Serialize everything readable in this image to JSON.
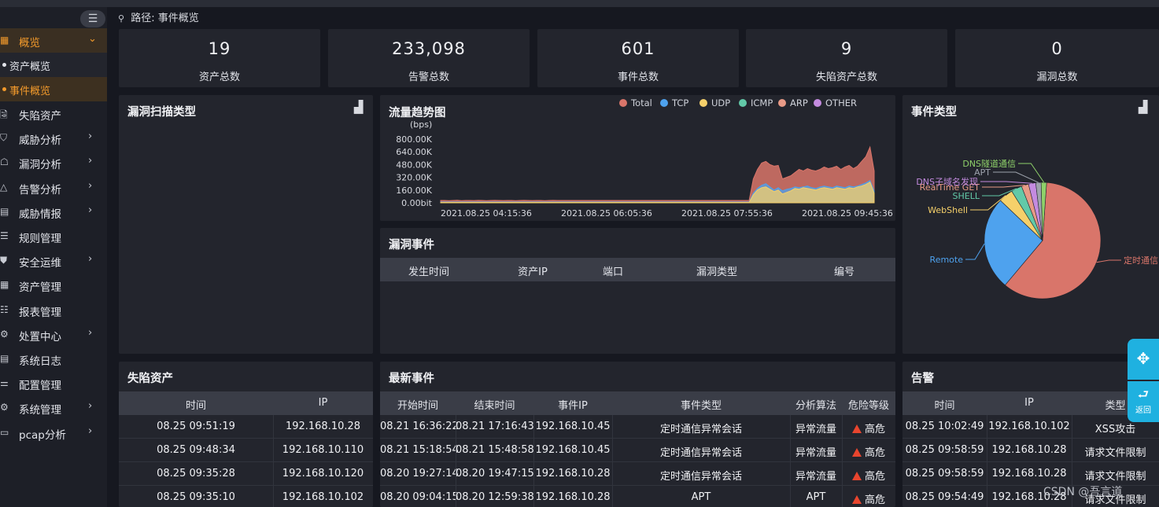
{
  "breadcrumb": {
    "prefix": "路径:",
    "current": "事件概览"
  },
  "sidebar": {
    "collapse_icon": "menu-fold-icon",
    "overview": {
      "label": "概览"
    },
    "sub_items": [
      {
        "label": "资产概览"
      },
      {
        "label": "事件概览"
      }
    ],
    "items": [
      {
        "label": "失陷资产"
      },
      {
        "label": "威胁分析"
      },
      {
        "label": "漏洞分析"
      },
      {
        "label": "告警分析"
      },
      {
        "label": "威胁情报"
      },
      {
        "label": "规则管理"
      },
      {
        "label": "安全运维"
      },
      {
        "label": "资产管理"
      },
      {
        "label": "报表管理"
      },
      {
        "label": "处置中心"
      },
      {
        "label": "系统日志"
      },
      {
        "label": "配置管理"
      },
      {
        "label": "系统管理"
      },
      {
        "label": "pcap分析"
      }
    ]
  },
  "stats": [
    {
      "value": "19",
      "label": "资产总数"
    },
    {
      "value": "233,098",
      "label": "告警总数"
    },
    {
      "value": "601",
      "label": "事件总数"
    },
    {
      "value": "9",
      "label": "失陷资产总数"
    },
    {
      "value": "0",
      "label": "漏洞总数"
    }
  ],
  "panels": {
    "vuln_scan": {
      "title": "漏洞扫描类型"
    },
    "traffic": {
      "title": "流量趋势图"
    },
    "event_type": {
      "title": "事件类型"
    },
    "vuln_events": {
      "title": "漏洞事件",
      "columns": [
        "发生时间",
        "资产IP",
        "端口",
        "漏洞类型",
        "编号"
      ]
    },
    "compromised": {
      "title": "失陷资产",
      "columns": [
        "时间",
        "IP"
      ],
      "rows": [
        [
          "08.25 09:51:19",
          "192.168.10.28"
        ],
        [
          "08.25 09:48:34",
          "192.168.10.110"
        ],
        [
          "08.25 09:35:28",
          "192.168.10.120"
        ],
        [
          "08.25 09:35:10",
          "192.168.10.102"
        ]
      ]
    },
    "latest_events": {
      "title": "最新事件",
      "columns": [
        "开始时间",
        "结束时间",
        "事件IP",
        "事件类型",
        "分析算法",
        "危险等级"
      ],
      "rows": [
        [
          "08.21 16:36:22",
          "08.21 17:16:43",
          "192.168.10.45",
          "定时通信异常会话",
          "异常流量",
          "高危"
        ],
        [
          "08.21 15:18:54",
          "08.21 15:48:58",
          "192.168.10.45",
          "定时通信异常会话",
          "异常流量",
          "高危"
        ],
        [
          "08.20 19:27:14",
          "08.20 19:47:15",
          "192.168.10.28",
          "定时通信异常会话",
          "异常流量",
          "高危"
        ],
        [
          "08.20 09:04:15",
          "08.20 12:59:38",
          "192.168.10.28",
          "APT",
          "APT",
          "高危"
        ]
      ]
    },
    "alerts": {
      "title": "告警",
      "columns": [
        "时间",
        "IP",
        "类型"
      ],
      "rows": [
        [
          "08.25 10:02:49",
          "192.168.10.102",
          "XSS攻击"
        ],
        [
          "08.25 09:58:59",
          "192.168.10.28",
          "请求文件限制"
        ],
        [
          "08.25 09:58:59",
          "192.168.10.28",
          "请求文件限制"
        ],
        [
          "08.25 09:54:49",
          "192.168.10.28",
          "请求文件限制"
        ]
      ]
    }
  },
  "chart_data": [
    {
      "type": "area",
      "title": "流量趋势图",
      "ylabel": "(bps)",
      "ytick_labels": [
        "800.00K",
        "640.00K",
        "480.00K",
        "320.00K",
        "160.00K",
        "0.00bit"
      ],
      "ylim": [
        0,
        800000
      ],
      "xtick_labels": [
        "2021.08.25 04:15:36",
        "2021.08.25 06:05:36",
        "2021.08.25 07:55:36",
        "2021.08.25 09:45:36"
      ],
      "legend_position": "top-right",
      "series": [
        {
          "name": "Total",
          "color": "#d9756a",
          "values": [
            30000,
            30000,
            28000,
            30000,
            32000,
            28000,
            30000,
            30000,
            29000,
            31000,
            30000,
            28000,
            30000,
            31000,
            30000,
            29000,
            30000,
            30000,
            28000,
            30000,
            31000,
            30000,
            29000,
            30000,
            30000,
            28000,
            30000,
            31000,
            30000,
            30000,
            30000,
            30000,
            30000,
            30000,
            30000,
            30000,
            30000,
            30000,
            30000,
            30000,
            30000,
            30000,
            30000,
            30000,
            30000,
            30000,
            30000,
            30000,
            30000,
            30000,
            30000,
            30000,
            30000,
            30000,
            30000,
            30000,
            30000,
            30000,
            30000,
            30000,
            30000,
            30000,
            30000,
            30000,
            30000,
            30000,
            30000,
            30000,
            30000,
            30000,
            30000,
            30000,
            30000,
            30000,
            30000,
            300000,
            420000,
            500000,
            520000,
            480000,
            460000,
            470000,
            300000,
            320000,
            340000,
            380000,
            420000,
            400000,
            430000,
            410000,
            400000,
            420000,
            450000,
            430000,
            440000,
            460000,
            420000,
            450000,
            470000,
            430000,
            460000,
            520000,
            580000,
            700000,
            400000
          ]
        },
        {
          "name": "TCP",
          "color": "#4ea2ee",
          "values": [
            10000,
            10000,
            10000,
            10000,
            10000,
            10000,
            10000,
            10000,
            10000,
            10000,
            10000,
            10000,
            10000,
            10000,
            10000,
            10000,
            10000,
            10000,
            10000,
            10000,
            10000,
            10000,
            10000,
            10000,
            10000,
            10000,
            10000,
            10000,
            10000,
            10000,
            10000,
            10000,
            10000,
            10000,
            10000,
            10000,
            10000,
            10000,
            10000,
            10000,
            10000,
            10000,
            10000,
            10000,
            10000,
            10000,
            10000,
            10000,
            10000,
            10000,
            10000,
            10000,
            10000,
            10000,
            10000,
            10000,
            10000,
            10000,
            10000,
            10000,
            10000,
            10000,
            10000,
            10000,
            10000,
            10000,
            10000,
            10000,
            10000,
            10000,
            10000,
            10000,
            10000,
            10000,
            10000,
            120000,
            180000,
            220000,
            240000,
            200000,
            160000,
            190000,
            150000,
            170000,
            180000,
            200000,
            190000,
            200000,
            210000,
            190000,
            180000,
            200000,
            210000,
            200000,
            190000,
            210000,
            200000,
            190000,
            210000,
            200000,
            210000,
            230000,
            250000,
            280000,
            150000
          ]
        },
        {
          "name": "UDP",
          "color": "#f5d06a",
          "values": [
            5000,
            5000,
            5000,
            5000,
            5000,
            5000,
            5000,
            5000,
            5000,
            5000,
            5000,
            5000,
            5000,
            5000,
            5000,
            5000,
            5000,
            5000,
            5000,
            5000,
            5000,
            5000,
            5000,
            5000,
            5000,
            5000,
            5000,
            5000,
            5000,
            5000,
            5000,
            5000,
            5000,
            5000,
            5000,
            5000,
            5000,
            5000,
            5000,
            5000,
            5000,
            5000,
            5000,
            5000,
            5000,
            5000,
            5000,
            5000,
            5000,
            5000,
            5000,
            5000,
            5000,
            5000,
            5000,
            5000,
            5000,
            5000,
            5000,
            5000,
            5000,
            5000,
            5000,
            5000,
            5000,
            5000,
            5000,
            5000,
            5000,
            5000,
            5000,
            5000,
            5000,
            5000,
            5000,
            100000,
            160000,
            190000,
            200000,
            170000,
            140000,
            160000,
            110000,
            130000,
            150000,
            180000,
            170000,
            190000,
            180000,
            170000,
            160000,
            180000,
            190000,
            180000,
            170000,
            190000,
            180000,
            170000,
            190000,
            180000,
            200000,
            210000,
            230000,
            260000,
            120000
          ]
        }
      ]
    },
    {
      "type": "pie",
      "title": "事件类型",
      "labels": [
        "定时通信",
        "Remote",
        "WebShell",
        "SHELL",
        "RealTime GET",
        "DNS子域名发现",
        "APT",
        "DNS隧道通信"
      ],
      "values": [
        60,
        26,
        4,
        3,
        2,
        2,
        1.5,
        1.5
      ],
      "colors": [
        "#d9756a",
        "#4ea2ee",
        "#f5d06a",
        "#62c9a8",
        "#e89a86",
        "#c48be0",
        "#9ea3ad",
        "#8fd16a"
      ]
    }
  ],
  "float_buttons": [
    {
      "icon": "move-icon"
    },
    {
      "label": "返回"
    }
  ],
  "watermark": "CSDN @吾言道"
}
